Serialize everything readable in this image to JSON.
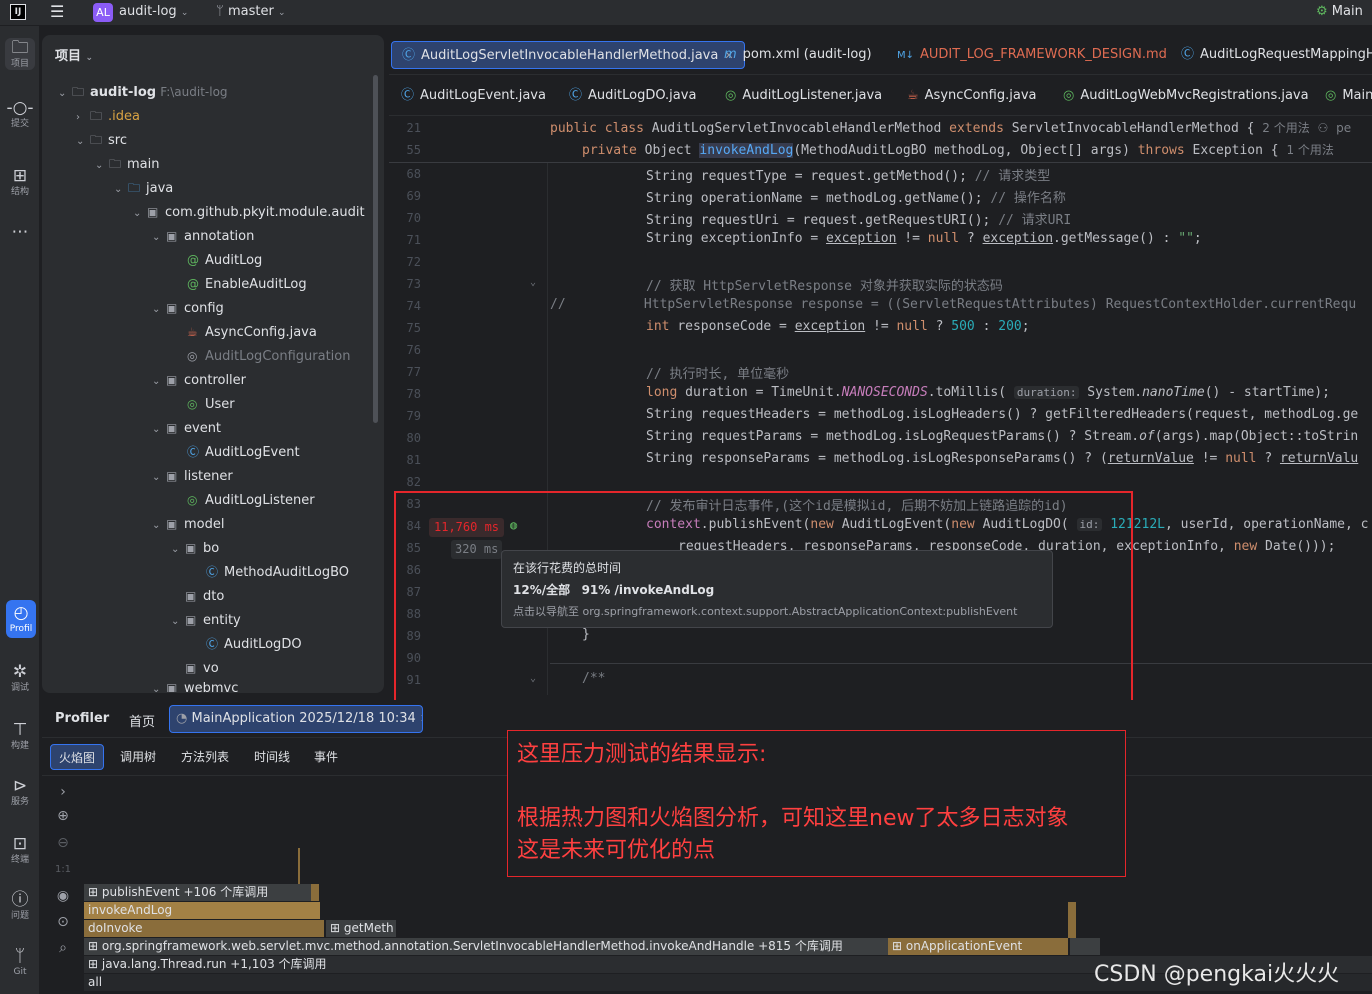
{
  "titlebar": {
    "project_badge": "AL",
    "project_name": "audit-log",
    "branch": "master",
    "run_config": "Main"
  },
  "leftbar": {
    "items": [
      {
        "label": "项目"
      },
      {
        "label": "提交"
      },
      {
        "label": "结构"
      },
      {
        "label": "Profil"
      },
      {
        "label": "调试"
      },
      {
        "label": "构建"
      },
      {
        "label": "服务"
      },
      {
        "label": "终端"
      },
      {
        "label": "问题"
      },
      {
        "label": "Git"
      }
    ]
  },
  "project_panel": {
    "title": "项目",
    "root_name": "audit-log",
    "root_path": "F:\\audit-log",
    "tree": [
      ".idea",
      "src",
      "main",
      "java",
      "com.github.pkyit.module.audit",
      "annotation",
      "AuditLog",
      "EnableAuditLog",
      "config",
      "AsyncConfig.java",
      "AuditLogConfiguration",
      "controller",
      "User",
      "event",
      "AuditLogEvent",
      "listener",
      "AuditLogListener",
      "model",
      "bo",
      "MethodAuditLogBO",
      "dto",
      "entity",
      "AuditLogDO",
      "vo",
      "webmvc"
    ]
  },
  "editor": {
    "tabs_row1": [
      "AuditLogServletInvocableHandlerMethod.java",
      "pom.xml (audit-log)",
      "AUDIT_LOG_FRAMEWORK_DESIGN.md",
      "AuditLogRequestMappingHar"
    ],
    "tabs_row2": [
      "AuditLogEvent.java",
      "AuditLogDO.java",
      "AuditLogListener.java",
      "AsyncConfig.java",
      "AuditLogWebMvcRegistrations.java",
      "Main"
    ],
    "line_numbers": [
      "21",
      "55",
      "68",
      "69",
      "70",
      "71",
      "72",
      "73",
      "74",
      "75",
      "76",
      "77",
      "78",
      "79",
      "80",
      "81",
      "82",
      "83",
      "84",
      "85",
      "86",
      "87",
      "88",
      "89",
      "90",
      "91"
    ],
    "sticky1_usage": "2 个用法",
    "sticky1_author": "pe",
    "sticky2_usage": "1 个用法",
    "comment_type": "// 请求类型",
    "comment_opname": "// 操作名称",
    "comment_uri": "// 请求URI",
    "comment_response": "// 获取 HttpServletResponse 对象并获取实际的状态码",
    "comment_duration": "// 执行时长, 单位毫秒",
    "comment_publish": "// 发布审计日志事件,(这个id是模拟id, 后期不妨加上链路追踪的id)",
    "hint_duration": "duration:",
    "hint_id": "id:",
    "id_value": "121212L",
    "num_500": "500",
    "num_200": "200",
    "str_empty": "\"\"",
    "timing_main": "11,760 ms",
    "timing_sub": "320 ms"
  },
  "tooltip": {
    "title": "在该行花费的总时间",
    "pct_all": "12%/全部",
    "pct_method": "91% /invokeAndLog",
    "nav_hint": "点击以导航至 org.springframework.context.support.AbstractApplicationContext:publishEvent"
  },
  "annotation_box": {
    "line1": "这里压力测试的结果显示:",
    "line2": "根据热力图和火焰图分析，可知这里new了太多日志对象",
    "line3": "这是未来可优化的点"
  },
  "profiler": {
    "title": "Profiler",
    "home_tab": "首页",
    "session_tab": "MainApplication 2025/12/18 10:34",
    "subtabs": [
      "火焰图",
      "调用树",
      "方法列表",
      "时间线",
      "事件"
    ],
    "zoom_label": "1:1",
    "frames": {
      "publishEvent": "publishEvent +106 个库调用",
      "invokeAndLog": "invokeAndLog",
      "doInvoke": "doInvoke",
      "getMethod": "getMeth",
      "invokeAndHandle": "org.springframework.web.servlet.mvc.method.annotation.ServletInvocableHandlerMethod.invokeAndHandle +815 个库调用",
      "onApplicationEvent": "onApplicationEvent",
      "threadRun": "java.lang.Thread.run +1,103 个库调用",
      "all": "all"
    }
  },
  "watermark": "CSDN @pengkai火火火",
  "colors": {
    "accent": "#3574f0",
    "annotation_red": "#e5262b",
    "timing_red": "#e5262b",
    "flame_tan": "#8a6d3b"
  }
}
